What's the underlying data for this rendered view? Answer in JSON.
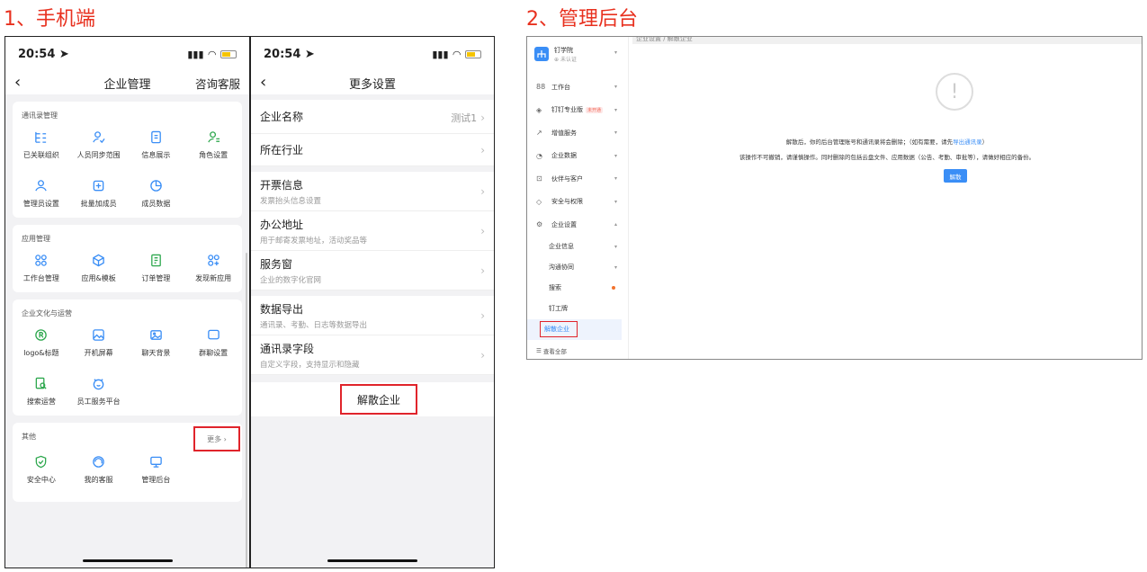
{
  "titles": {
    "mobile": "1、手机端",
    "admin": "2、管理后台"
  },
  "phone1": {
    "time": "20:54",
    "nav_title": "企业管理",
    "nav_right": "咨询客服",
    "sections": [
      {
        "title": "通讯录管理",
        "items": [
          "已关联组织",
          "人员同步范围",
          "信息展示",
          "角色设置",
          "管理员设置",
          "批量加成员",
          "成员数据"
        ]
      },
      {
        "title": "应用管理",
        "items": [
          "工作台管理",
          "应用&模板",
          "订单管理",
          "发现新应用"
        ]
      },
      {
        "title": "企业文化与运营",
        "items": [
          "logo&标题",
          "开机屏幕",
          "聊天背景",
          "群聊设置",
          "搜索运营",
          "员工服务平台"
        ]
      },
      {
        "title": "其他",
        "more": "更多",
        "items": [
          "安全中心",
          "我的客服",
          "管理后台"
        ]
      }
    ]
  },
  "phone2": {
    "time": "20:54",
    "nav_title": "更多设置",
    "rows": [
      {
        "label": "企业名称",
        "value": "测试1"
      },
      {
        "label": "所在行业"
      },
      {
        "label": "开票信息",
        "desc": "发票抬头信息设置"
      },
      {
        "label": "办公地址",
        "desc": "用于邮寄发票地址，活动奖品等"
      },
      {
        "label": "服务窗",
        "desc": "企业的数字化官网"
      },
      {
        "label": "数据导出",
        "desc": "通讯录、考勤、日志等数据导出"
      },
      {
        "label": "通讯录字段",
        "desc": "自定义字段，支持显示和隐藏"
      }
    ],
    "dissolve": "解散企业"
  },
  "admin": {
    "org_name": "钉学院",
    "org_status": "未认证",
    "breadcrumb": "企业设置 / 解散企业",
    "menu": [
      {
        "label": "工作台"
      },
      {
        "label": "钉钉专业版",
        "badge": "未开通"
      },
      {
        "label": "增值服务"
      },
      {
        "label": "企业数据"
      },
      {
        "label": "伙伴与客户"
      },
      {
        "label": "安全与权限"
      },
      {
        "label": "企业设置"
      }
    ],
    "submenu": [
      "企业信息",
      "沟通协同",
      "搜索",
      "钉工牌",
      "解散企业"
    ],
    "view_all": "查看全部",
    "notice_line1_a": "解散后，你的后台管理账号和通讯录将会删除；（如有需要，请先",
    "notice_link": "导出通讯录",
    "notice_line1_b": "）",
    "notice_line2": "该操作不可撤销，请谨慎操作。同时删除的包括云盘文件、应用数据（公告、考勤、审批等），请做好相应的备份。",
    "button": "解散",
    "colors": {
      "accent": "#3a8ef6",
      "highlight": "#e0242b"
    }
  }
}
